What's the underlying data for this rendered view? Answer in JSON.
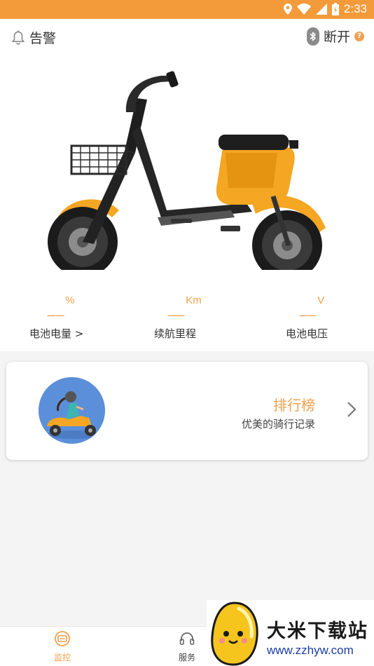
{
  "status_bar": {
    "time": "2:33",
    "bg_color": "#f39a3a"
  },
  "header": {
    "alarm_label": "告警",
    "alarm_icon": "bell-icon",
    "bt_label": "断开",
    "bt_icon": "bluetooth-icon",
    "help_icon": "question-icon"
  },
  "stats": [
    {
      "value": "__",
      "unit": "%",
      "label": "电池电量 >"
    },
    {
      "value": "__",
      "unit": "Km",
      "label": "续航里程"
    },
    {
      "value": "__",
      "unit": "V",
      "label": "电池电压"
    }
  ],
  "rank_card": {
    "title": "排行榜",
    "subtitle": "优美的骑行记录",
    "icon": "chevron-right-icon"
  },
  "tabs": [
    {
      "label": "监控",
      "icon": "monitor-icon",
      "active": true
    },
    {
      "label": "服务",
      "icon": "headset-icon",
      "active": false
    }
  ],
  "watermark": {
    "title": "大米下载站",
    "url": "www.zzhyw.com"
  },
  "colors": {
    "accent": "#f2a04c",
    "text": "#333333"
  }
}
